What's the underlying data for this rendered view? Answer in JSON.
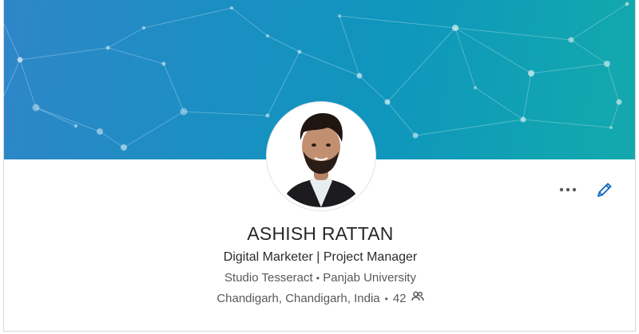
{
  "profile": {
    "name": "ASHISH RATTAN",
    "headline": "Digital Marketer | Project Manager",
    "company": "Studio Tesseract",
    "education": "Panjab University",
    "location": "Chandigarh, Chandigarh, India",
    "connections": "42",
    "separator": "•"
  },
  "actions": {
    "more_icon": "more-horizontal-icon",
    "edit_icon": "pencil-icon"
  },
  "colors": {
    "banner_start": "#2f86c8",
    "banner_end": "#14a9ad",
    "accent": "#0a66c2"
  }
}
